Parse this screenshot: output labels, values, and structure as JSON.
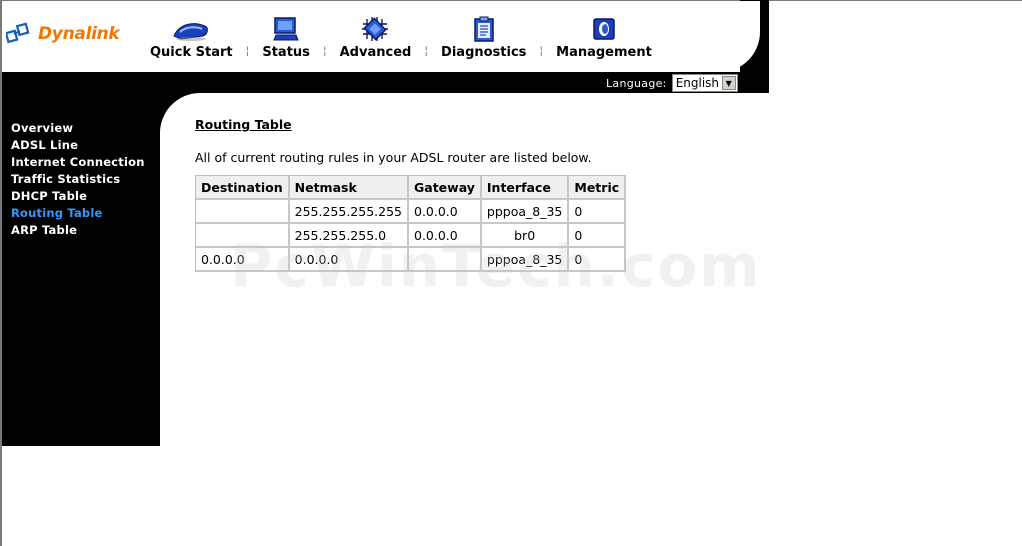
{
  "brand": {
    "name": "Dynalink",
    "color": "#f07800"
  },
  "nav": [
    {
      "label": "Quick Start",
      "icon": "quick-start-icon"
    },
    {
      "label": "Status",
      "icon": "monitor-icon"
    },
    {
      "label": "Advanced",
      "icon": "chip-icon"
    },
    {
      "label": "Diagnostics",
      "icon": "clipboard-icon"
    },
    {
      "label": "Management",
      "icon": "management-icon"
    }
  ],
  "language": {
    "label": "Language:",
    "selected": "English"
  },
  "sidebar": {
    "items": [
      {
        "label": "Overview"
      },
      {
        "label": "ADSL Line"
      },
      {
        "label": "Internet Connection"
      },
      {
        "label": "Traffic Statistics"
      },
      {
        "label": "DHCP Table"
      },
      {
        "label": "Routing Table",
        "active": true
      },
      {
        "label": "ARP Table"
      }
    ],
    "active_color": "#3399ff"
  },
  "main": {
    "title": "Routing Table",
    "description": "All of current routing rules in your ADSL router are listed below.",
    "table": {
      "headers": [
        "Destination",
        "Netmask",
        "Gateway",
        "Interface",
        "Metric"
      ],
      "rows": [
        [
          "",
          "255.255.255.255",
          "0.0.0.0",
          "pppoa_8_35",
          "0"
        ],
        [
          "",
          "255.255.255.0",
          "0.0.0.0",
          "br0",
          "0"
        ],
        [
          "0.0.0.0",
          "0.0.0.0",
          "",
          "pppoa_8_35",
          "0"
        ]
      ]
    }
  },
  "watermark": "PcWinTech.com"
}
